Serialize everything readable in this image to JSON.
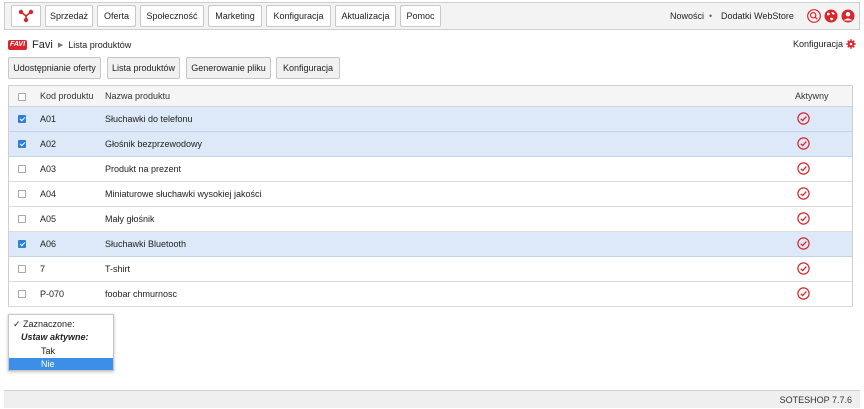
{
  "nav": {
    "items": [
      {
        "label": "Sprzedaż"
      },
      {
        "label": "Oferta"
      },
      {
        "label": "Społeczność"
      },
      {
        "label": "Marketing"
      },
      {
        "label": "Konfiguracja"
      },
      {
        "label": "Aktualizacja"
      },
      {
        "label": "Pomoc"
      }
    ],
    "right_links": {
      "news": "Nowości",
      "separator": "•",
      "webstore": "Dodatki WebStore"
    }
  },
  "breadcrumb": {
    "badge": "FAVI",
    "title": "Favi",
    "arrow": "▶",
    "current": "Lista produktów"
  },
  "config_link": "Konfiguracja",
  "tabs": [
    {
      "label": "Udostępnianie oferty"
    },
    {
      "label": "Lista produktów"
    },
    {
      "label": "Generowanie pliku"
    },
    {
      "label": "Konfiguracja"
    }
  ],
  "table": {
    "headers": {
      "code": "Kod produktu",
      "name": "Nazwa produktu",
      "active": "Aktywny"
    },
    "rows": [
      {
        "code": "A01",
        "name": "Słuchawki do telefonu",
        "checked": true
      },
      {
        "code": "A02",
        "name": "Głośnik bezprzewodowy",
        "checked": true
      },
      {
        "code": "A03",
        "name": "Produkt na prezent",
        "checked": false
      },
      {
        "code": "A04",
        "name": "Miniaturowe słuchawki wysokiej jakości",
        "checked": false
      },
      {
        "code": "A05",
        "name": "Mały głośnik",
        "checked": false
      },
      {
        "code": "A06",
        "name": "Słuchawki Bluetooth",
        "checked": true
      },
      {
        "code": "7",
        "name": "T-shirt",
        "checked": false
      },
      {
        "code": "P-070",
        "name": "foobar chmurnosc",
        "checked": false
      }
    ]
  },
  "dropdown": {
    "selected_label": "✓ Zaznaczone:",
    "group_label": "Ustaw aktywne:",
    "options": [
      "Tak",
      "Nie"
    ],
    "highlighted": "Nie"
  },
  "footer": {
    "version": "SOTESHOP 7.7.6"
  },
  "colors": {
    "brand_red": "#d9262c",
    "selected_row": "#dde8f8",
    "highlight": "#3d8ee6"
  }
}
